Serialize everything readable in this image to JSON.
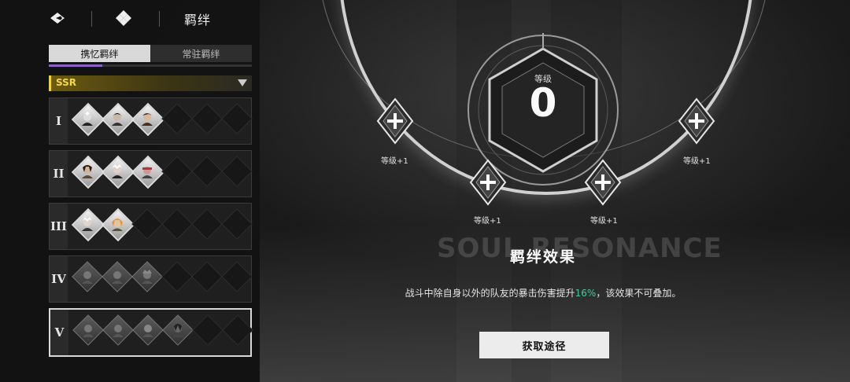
{
  "header": {
    "title": "羁绊"
  },
  "tabs": [
    {
      "label": "携忆羁绊",
      "active": true
    },
    {
      "label": "常驻羁绊",
      "active": false
    }
  ],
  "filter": {
    "selected": "SSR"
  },
  "tiers": [
    {
      "label": "I",
      "slots": [
        "filled",
        "filled",
        "filled",
        "empty",
        "empty",
        "empty"
      ]
    },
    {
      "label": "II",
      "slots": [
        "filled",
        "filled",
        "filled",
        "empty",
        "empty",
        "empty"
      ]
    },
    {
      "label": "III",
      "slots": [
        "filled",
        "filled",
        "empty",
        "empty",
        "empty",
        "empty"
      ]
    },
    {
      "label": "IV",
      "slots": [
        "gray",
        "gray",
        "gray",
        "empty",
        "empty",
        "empty"
      ]
    },
    {
      "label": "V",
      "slots": [
        "gray",
        "gray",
        "gray",
        "gray",
        "empty",
        "empty"
      ]
    }
  ],
  "resonance": {
    "level_label": "等级",
    "level_value": "0",
    "nodes": [
      {
        "caption": "等级+1"
      },
      {
        "caption": "等级+1"
      },
      {
        "caption": "等级+1"
      },
      {
        "caption": "等级+1"
      }
    ]
  },
  "watermark": "SOUL RESONANCE",
  "effect": {
    "title": "羁绊效果",
    "desc_prefix": "战斗中除自身以外的队友的暴击伤害提升",
    "desc_value": "16%",
    "desc_suffix": "，该效果不可叠加。"
  },
  "cta_label": "获取途径",
  "colors": {
    "accent_purple": "#8a63c7",
    "ssr_gold": "#f4d84a",
    "highlight_green": "#44c99c"
  }
}
